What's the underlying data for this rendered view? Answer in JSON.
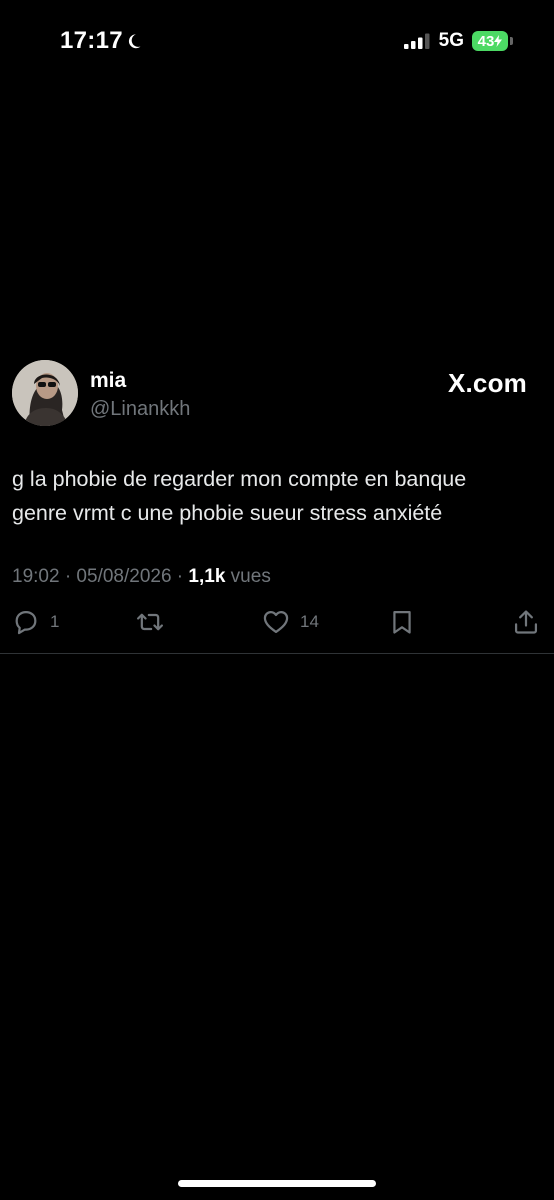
{
  "status_bar": {
    "time": "17:17",
    "network": "5G",
    "battery": "43"
  },
  "tweet": {
    "author_name": "mia",
    "author_handle": "@Linankkh",
    "source": "X.com",
    "text_line1": "g la phobie de regarder mon compte en banque",
    "text_line2": "genre vrmt c une phobie sueur stress anxiété",
    "timestamp": "19:02 · 05/08/2026 · ",
    "views_count": "1,1k",
    "views_label": " vues",
    "reply_count": "1",
    "like_count": "14"
  },
  "icons": {
    "moon": "moon-icon",
    "signal": "signal-icon",
    "battery": "battery-icon",
    "reply": "reply-icon",
    "retweet": "retweet-icon",
    "like": "heart-icon",
    "bookmark": "bookmark-icon",
    "share": "share-icon"
  },
  "colors": {
    "background": "#000000",
    "text": "#e7e9ea",
    "muted": "#71767b",
    "battery": "#4cd964",
    "divider": "#2f3336"
  }
}
